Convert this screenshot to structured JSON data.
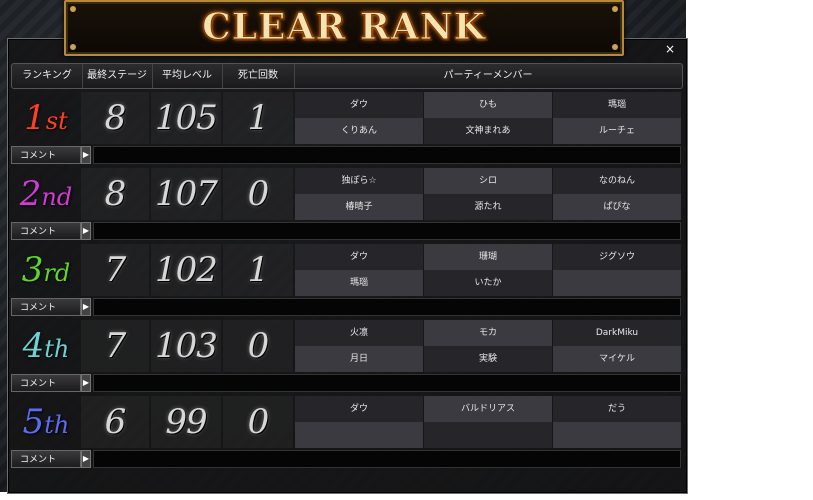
{
  "window": {
    "title": "CLEAR RANK",
    "close_symbol": "×"
  },
  "headers": [
    "ランキング",
    "最終ステージ",
    "平均レベル",
    "死亡回数",
    "パーティーメンバー"
  ],
  "comment_label": "コメント",
  "rows": [
    {
      "rank_num": "1",
      "rank_suffix": "st",
      "color": "#ff4020",
      "stage": "8",
      "level": "105",
      "deaths": "1",
      "members": [
        "ダウ",
        "ひも",
        "瑪瑙",
        "くりあん",
        "文神まれあ",
        "ルーチェ"
      ]
    },
    {
      "rank_num": "2",
      "rank_suffix": "nd",
      "color": "#d23ad6",
      "stage": "8",
      "level": "107",
      "deaths": "0",
      "members": [
        "独ぽら☆",
        "シロ",
        "なのねん",
        "椿晴子",
        "源たれ",
        "ぱぴな"
      ]
    },
    {
      "rank_num": "3",
      "rank_suffix": "rd",
      "color": "#5fd42a",
      "stage": "7",
      "level": "102",
      "deaths": "1",
      "members": [
        "ダウ",
        "珊瑚",
        "ジグソウ",
        "瑪瑙",
        "いたか",
        ""
      ]
    },
    {
      "rank_num": "4",
      "rank_suffix": "th",
      "color": "#6fd2d0",
      "stage": "7",
      "level": "103",
      "deaths": "0",
      "members": [
        "火凛",
        "モカ",
        "DarkMiku",
        "月日",
        "実験",
        "マイケル"
      ]
    },
    {
      "rank_num": "5",
      "rank_suffix": "th",
      "color": "#5a6cf0",
      "stage": "6",
      "level": "99",
      "deaths": "0",
      "members": [
        "ダウ",
        "バルドリアス",
        "だう",
        "",
        "",
        ""
      ]
    }
  ]
}
